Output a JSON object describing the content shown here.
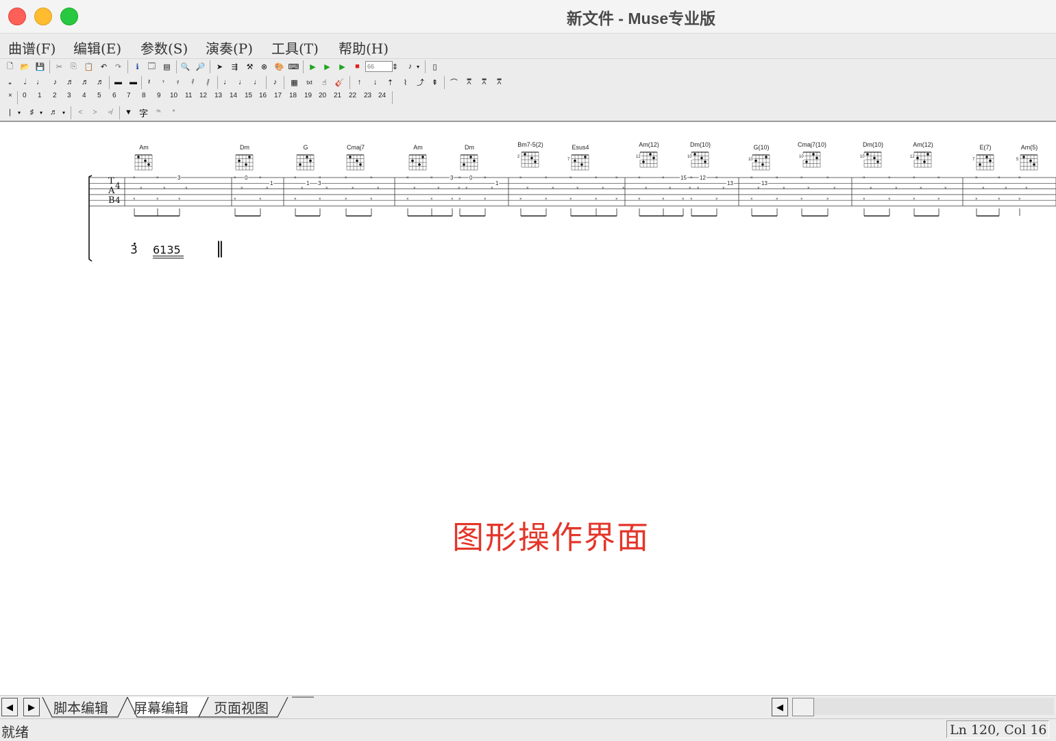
{
  "window": {
    "title": "新文件 - Muse专业版"
  },
  "menu": [
    "曲谱(F)",
    "编辑(E)",
    "参数(S)",
    "演奏(P)",
    "工具(T)",
    "帮助(H)"
  ],
  "toolbar": {
    "tempo_value": "66"
  },
  "number_bar": [
    "×",
    "0",
    "1",
    "2",
    "3",
    "4",
    "5",
    "6",
    "7",
    "8",
    "9",
    "10",
    "11",
    "12",
    "13",
    "14",
    "15",
    "16",
    "17",
    "18",
    "19",
    "20",
    "21",
    "22",
    "23",
    "24"
  ],
  "chords": [
    {
      "name": "Am",
      "fret": ""
    },
    {
      "name": "Dm",
      "fret": ""
    },
    {
      "name": "G",
      "fret": ""
    },
    {
      "name": "Cmaj7",
      "fret": ""
    },
    {
      "name": "Am",
      "fret": ""
    },
    {
      "name": "Dm",
      "fret": ""
    },
    {
      "name": "Bm7-5(2)",
      "fret": "2"
    },
    {
      "name": "Esus4",
      "fret": "7"
    },
    {
      "name": "Am(12)",
      "fret": "12"
    },
    {
      "name": "Dm(10)",
      "fret": "10"
    },
    {
      "name": "G(10)",
      "fret": "10"
    },
    {
      "name": "Cmaj7(10)",
      "fret": "10"
    },
    {
      "name": "Dm(10)",
      "fret": "10"
    },
    {
      "name": "Am(12)",
      "fret": "12"
    },
    {
      "name": "E(7)",
      "fret": "7"
    },
    {
      "name": "Am(5)",
      "fret": "5"
    }
  ],
  "staff": {
    "clef": [
      "T",
      "A",
      "B"
    ],
    "time_signature": [
      "4",
      "4"
    ],
    "numbers": [
      "3",
      "0",
      "1",
      "1",
      "3",
      "3",
      "0",
      "1",
      "15",
      "12",
      "13",
      "13"
    ]
  },
  "jianpu": {
    "note_1": "3",
    "group": "6135",
    "barline": "‖"
  },
  "overlay_text": "图形操作界面",
  "tabs": [
    "脚本编辑",
    "屏幕编辑",
    "页面视图"
  ],
  "status": {
    "left": "就绪",
    "right": "Ln 120, Col 16"
  }
}
